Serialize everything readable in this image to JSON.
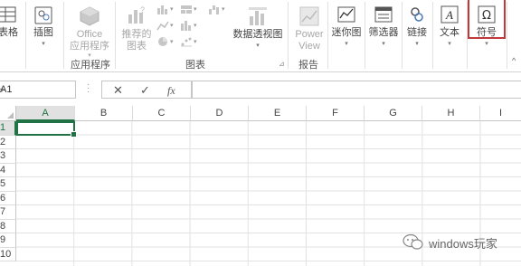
{
  "ribbon": {
    "table_label": "表格",
    "illustrations_label": "插图",
    "office_line1": "Office",
    "office_line2": "应用程序",
    "recommended_line1": "推荐的",
    "recommended_line2": "图表",
    "pivotchart_label": "数据透视图",
    "powerview_line1": "Power",
    "powerview_line2": "View",
    "sparklines_label": "迷你图",
    "filters_label": "筛选器",
    "links_label": "链接",
    "text_label": "文本",
    "symbols_label": "符号",
    "groups": {
      "apps": "应用程序",
      "charts": "图表",
      "reports": "报告"
    }
  },
  "formula_bar": {
    "name_box": "A1",
    "cancel_glyph": "✕",
    "enter_glyph": "✓",
    "fx_glyph": "fx",
    "formula_value": ""
  },
  "grid": {
    "columns": [
      "A",
      "B",
      "C",
      "D",
      "E",
      "F",
      "G",
      "H",
      "I"
    ],
    "rows": [
      "1",
      "2",
      "3",
      "4",
      "5",
      "6",
      "7",
      "8",
      "9",
      "10"
    ],
    "active_cell": "A1"
  },
  "watermark": {
    "text": "windows玩家"
  },
  "colors": {
    "excel_green": "#217346",
    "highlight_red": "#c0393b"
  }
}
